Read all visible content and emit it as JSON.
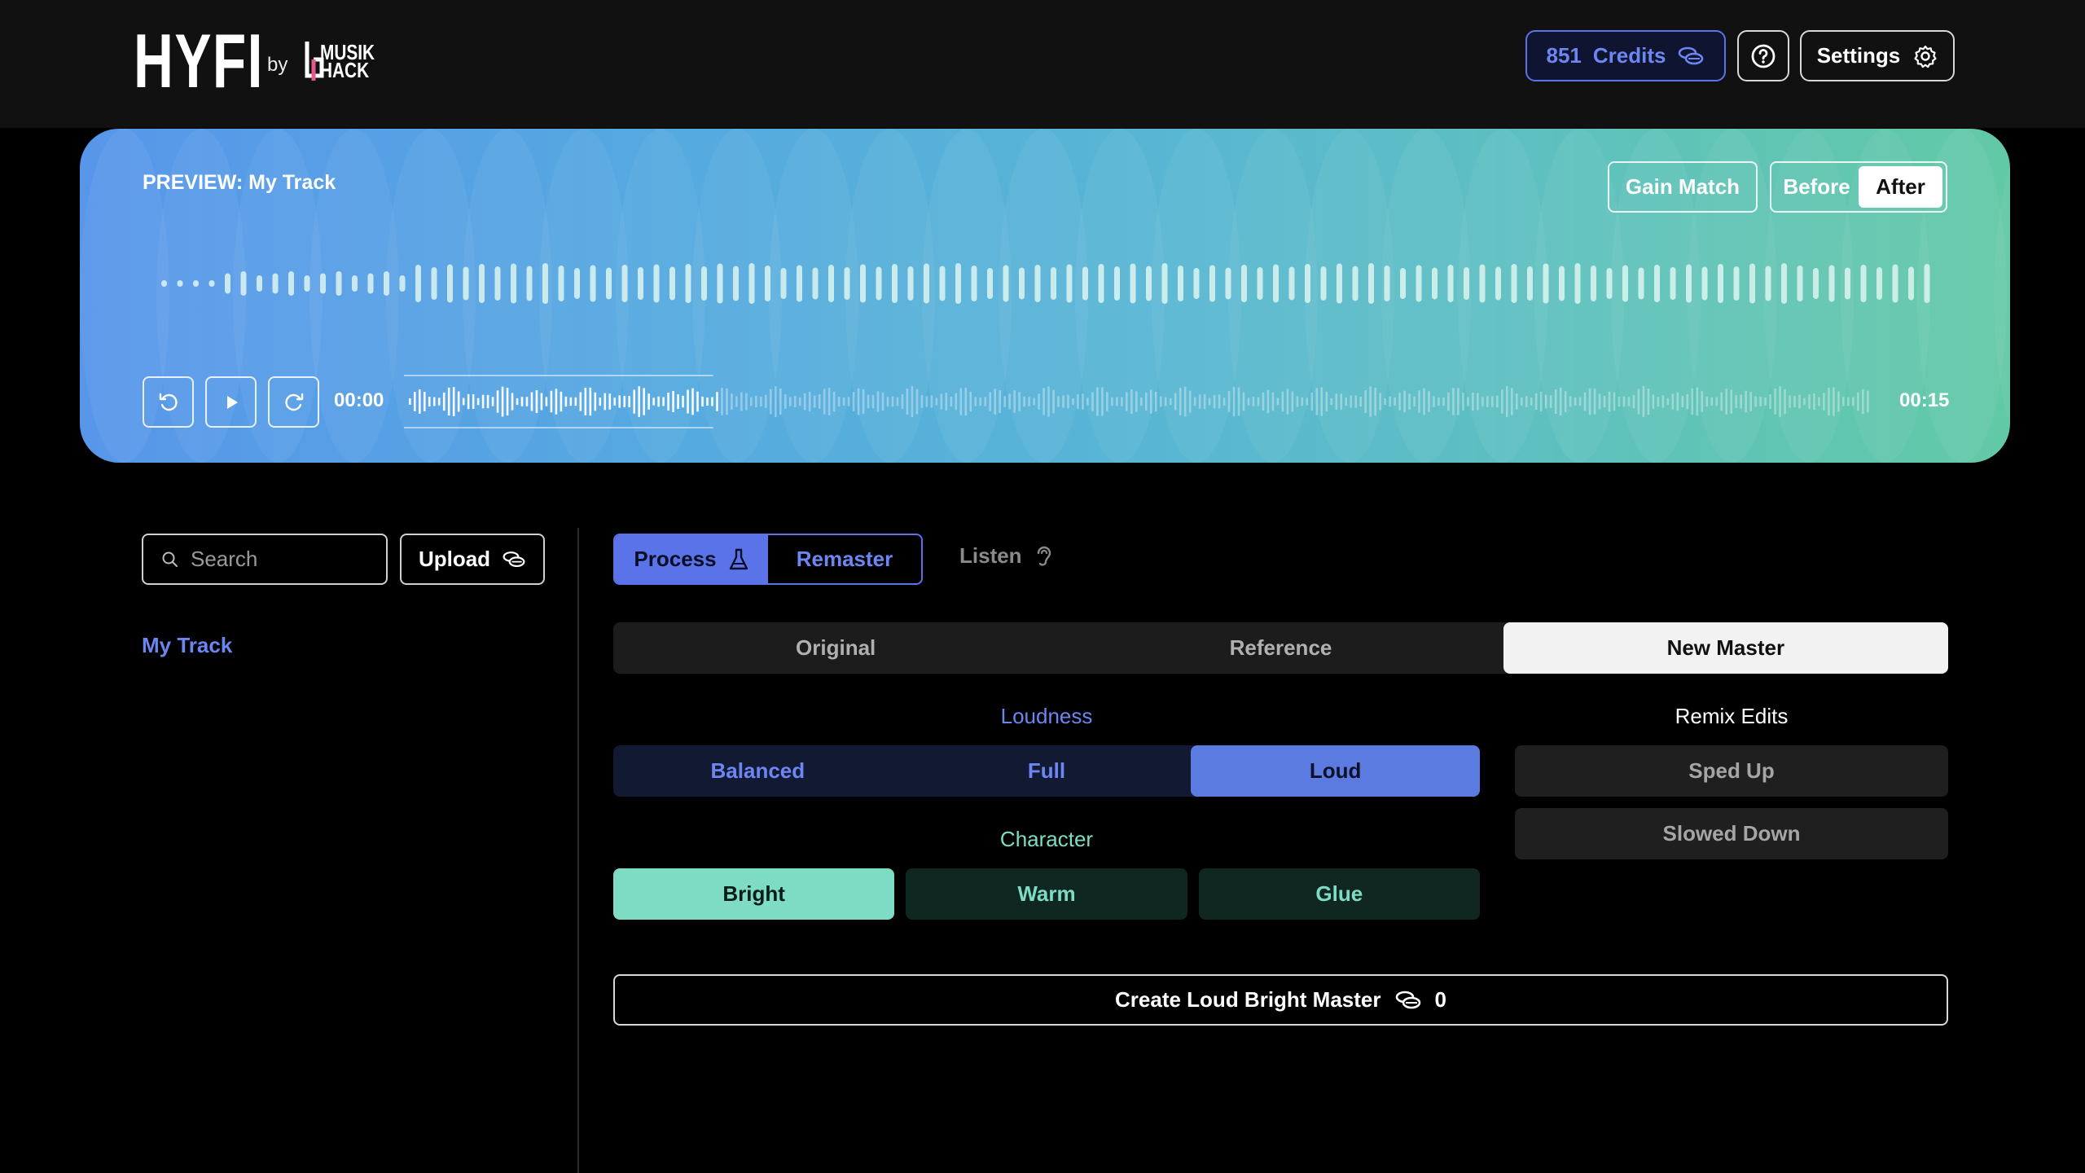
{
  "app": {
    "logo": "HYFI",
    "by": "by",
    "brand_line1": "MUSIK",
    "brand_line2": "HACK"
  },
  "header": {
    "credits_count": "851",
    "credits_label": "Credits",
    "settings_label": "Settings"
  },
  "preview": {
    "title": "PREVIEW: My Track",
    "gain_match": "Gain Match",
    "before": "Before",
    "after": "After",
    "selected": "After",
    "current_time": "00:00",
    "duration": "00:15",
    "played_fraction": 0.21
  },
  "sidebar": {
    "search_placeholder": "Search",
    "upload_label": "Upload",
    "tracks": [
      "My Track"
    ]
  },
  "main": {
    "mode_tabs": [
      "Process",
      "Remaster"
    ],
    "mode_selected": "Process",
    "listen_label": "Listen",
    "view_tabs": [
      "Original",
      "Reference",
      "New Master"
    ],
    "view_selected": "New Master",
    "loudness_label": "Loudness",
    "loudness_options": [
      "Balanced",
      "Full",
      "Loud"
    ],
    "loudness_selected": "Loud",
    "character_label": "Character",
    "character_options": [
      "Bright",
      "Warm",
      "Glue"
    ],
    "character_selected": "Bright",
    "remix_label": "Remix Edits",
    "remix_options": [
      "Sped Up",
      "Slowed Down"
    ],
    "create_label": "Create Loud Bright Master",
    "create_cost": "0"
  },
  "colors": {
    "accent_blue": "#5b73e8",
    "accent_teal": "#7fdcc4"
  }
}
